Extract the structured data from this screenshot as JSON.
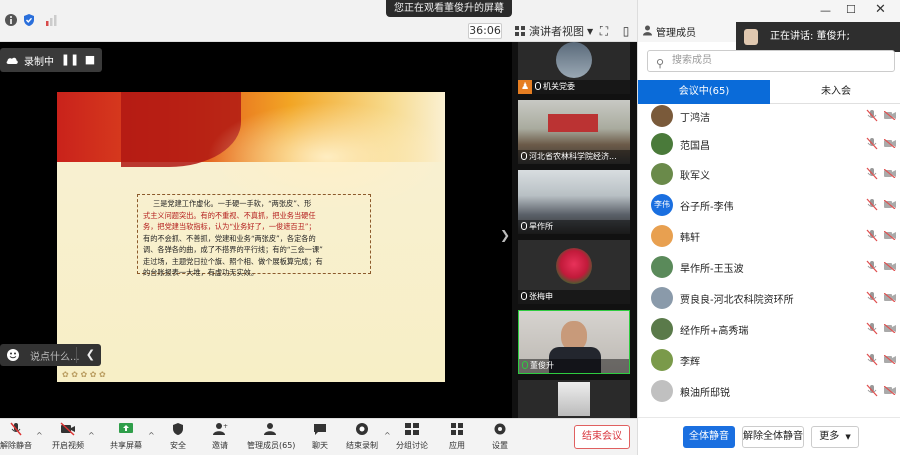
{
  "top": {
    "share_banner": "您正在观看董俊升的屏幕",
    "timer": "36:06",
    "view_mode": "演讲者视图"
  },
  "stage": {
    "recording_label": "录制中",
    "chat_placeholder": "说点什么...",
    "slide": {
      "line1": "三是党建工作虚化。一手硬一手软，“两张皮”、形",
      "line2": "式主义问题突出。有的不重视、不真抓，把业务当硬任",
      "line3": "务，把党建当软指标，认为“业务好了，一俊遮百丑”；",
      "line4": "有的不会抓、不善抓，党建和业务“两张皮”，各定各的",
      "line5": "调、各弹各的曲，成了不搭界的平行线；有的“三会一课”",
      "line6": "走过场，主题党日拉个旗、照个相、做个展板算完成；有",
      "line7": "的台账报表一大堆，有虚功无实效。"
    }
  },
  "strip": {
    "tiles": [
      {
        "name": "机关党委"
      },
      {
        "name": "河北省农林科学院经济..."
      },
      {
        "name": "旱作所"
      },
      {
        "name": "张梅申"
      },
      {
        "name": "董俊升"
      }
    ]
  },
  "toolbar": {
    "unmute": "解除静音",
    "video": "开启视频",
    "share": "共享屏幕",
    "security": "安全",
    "invite": "邀请",
    "members": "管理成员(65)",
    "chat": "聊天",
    "record": "结束录制",
    "breakout": "分组讨论",
    "apps": "应用",
    "settings": "设置",
    "end_meeting": "结束会议"
  },
  "panel": {
    "title": "管理成员",
    "speaking": "正在讲话: 董俊升;",
    "search_placeholder": "搜索成员",
    "tab_in": "会议中(65)",
    "tab_out": "未入会",
    "members": [
      {
        "name": "丁鸿洁",
        "avatar_text": "",
        "color": "#7a5a3a"
      },
      {
        "name": "范国昌",
        "avatar_text": "",
        "color": "#4a7a3a"
      },
      {
        "name": "耿军义",
        "avatar_text": "",
        "color": "#6a8a4a"
      },
      {
        "name": "谷子所-李伟",
        "avatar_text": "李伟",
        "color": "#1a6fe0"
      },
      {
        "name": "韩轩",
        "avatar_text": "",
        "color": "#e8a050"
      },
      {
        "name": "旱作所-王玉波",
        "avatar_text": "",
        "color": "#5a8a5a"
      },
      {
        "name": "贾良良-河北农科院资环所",
        "avatar_text": "",
        "color": "#8a9aaa"
      },
      {
        "name": "经作所+高秀瑞",
        "avatar_text": "",
        "color": "#5a7a4a"
      },
      {
        "name": "李辉",
        "avatar_text": "",
        "color": "#7a9a4a"
      },
      {
        "name": "粮油所邸锐",
        "avatar_text": "",
        "color": "#c0c0c0"
      }
    ],
    "mute_all": "全体静音",
    "unmute_all": "解除全体静音",
    "more": "更多"
  }
}
